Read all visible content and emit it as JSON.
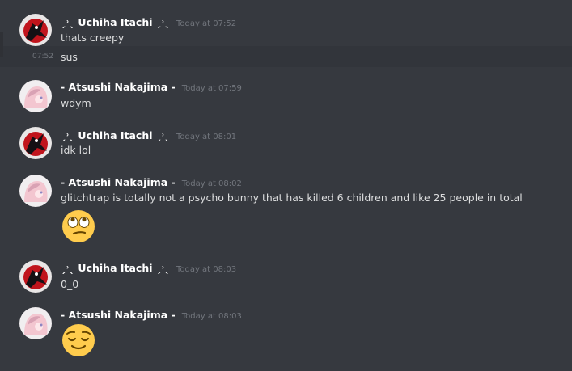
{
  "messages": [
    {
      "author": "ˏ˒ˎ Uchiha Itachi ˏ˒ˎ",
      "timestamp": "Today at 07:52",
      "lines": [
        "thats creepy"
      ],
      "avatar": "itachi-avatar"
    },
    {
      "continuation": true,
      "hover_time": "07:52",
      "lines": [
        "sus"
      ]
    },
    {
      "author": "- Atsushi Nakajima -",
      "timestamp": "Today at 07:59",
      "lines": [
        "wdym"
      ],
      "avatar": "atsushi-avatar"
    },
    {
      "author": "ˏ˒ˎ Uchiha Itachi ˏ˒ˎ",
      "timestamp": "Today at 08:01",
      "lines": [
        "idk lol"
      ],
      "avatar": "itachi-avatar"
    },
    {
      "author": "- Atsushi Nakajima -",
      "timestamp": "Today at 08:02",
      "lines": [
        "glitchtrap is totally not a psycho bunny that has killed 6 children and like 25 people in total"
      ],
      "emoji": "face-with-rolling-eyes",
      "avatar": "atsushi-avatar"
    },
    {
      "author": "ˏ˒ˎ Uchiha Itachi ˏ˒ˎ",
      "timestamp": "Today at 08:03",
      "lines": [
        "0_0"
      ],
      "avatar": "itachi-avatar"
    },
    {
      "author": "- Atsushi Nakajima -",
      "timestamp": "Today at 08:03",
      "emoji": "relieved-face",
      "avatar": "atsushi-avatar"
    }
  ],
  "colors": {
    "background": "#36393f",
    "hover_row": "#32353b",
    "username": "#ffffff",
    "message_text": "#dcddde",
    "timestamp": "#72767d"
  }
}
